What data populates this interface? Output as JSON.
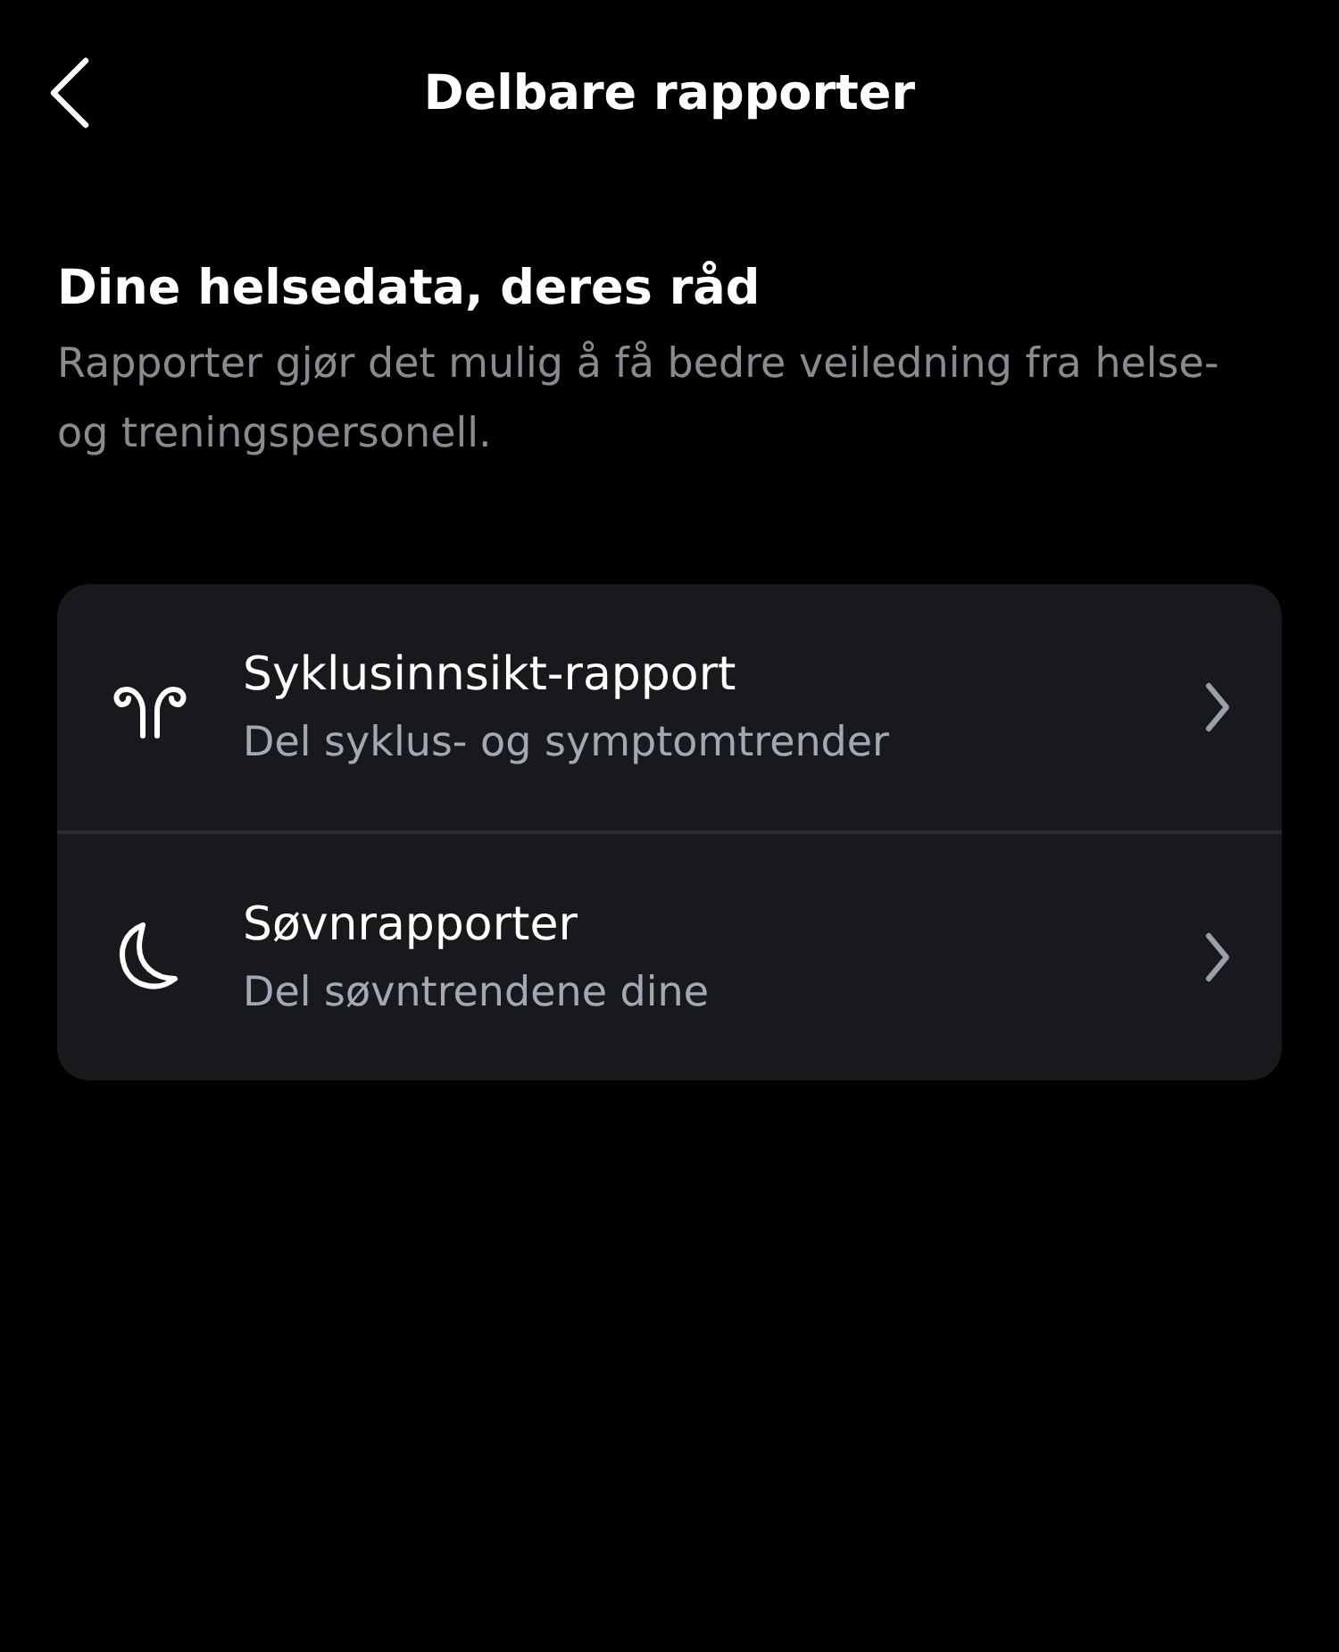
{
  "header": {
    "title": "Delbare rapporter"
  },
  "intro": {
    "heading": "Dine helsedata, deres råd",
    "text": "Rapporter gjør det mulig å få bedre veiledning fra helse- og treningspersonell."
  },
  "reports": [
    {
      "kind": "cycle",
      "title": "Syklusinnsikt-rapport",
      "subtitle": "Del syklus- og symptomtrender"
    },
    {
      "kind": "sleep",
      "title": "Søvnrapporter",
      "subtitle": "Del søvntrendene dine"
    }
  ]
}
